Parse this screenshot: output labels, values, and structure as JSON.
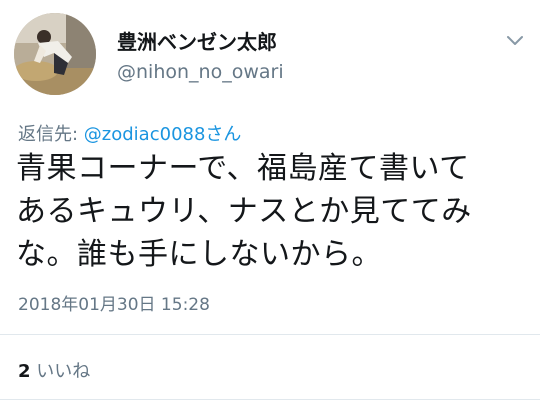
{
  "user": {
    "display_name": "豊洲ベンゼン太郎",
    "handle": "@nihon_no_owari"
  },
  "reply": {
    "prefix": "返信先: ",
    "to_user": "@zodiac0088さん"
  },
  "tweet": {
    "text": "青果コーナーで、福島産て書いて\nあるキュウリ、ナスとか見ててみ\nな。誰も手にしないから。",
    "timestamp": "2018年01月30日 15:28"
  },
  "stats": {
    "like_count": "2",
    "like_label": " いいね"
  },
  "icons": {
    "menu": "chevron-down-icon",
    "avatar": "avatar-photo"
  },
  "colors": {
    "link": "#1b95e0",
    "secondary_text": "#657786",
    "primary_text": "#14171a",
    "divider": "#e1e8ed"
  }
}
